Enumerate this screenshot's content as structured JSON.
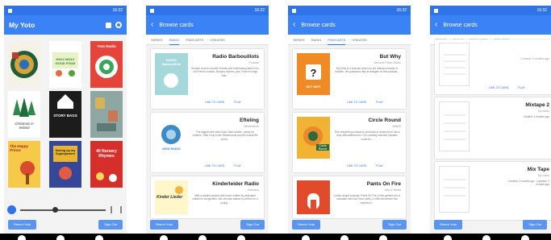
{
  "screens": [
    {
      "status_time": "16:32",
      "title": "My Yoto",
      "tile_texts": {
        "t2": "HOLY MOLY GOOD FOOD",
        "t3": "Yoto Radio",
        "t4": "Christmas in Ireland",
        "t5": "STORY BAGS",
        "t7": "The Happy Prince",
        "t8": "Saving up my Superpowers",
        "t9": "40 Nursery Rhymes"
      },
      "buttons": {
        "left": "Return Yoto",
        "right": "Sign Out"
      }
    },
    {
      "status_time": "16:32",
      "title": "Browse cards",
      "tabs": [
        "SERIES",
        "RADIO",
        "PODCASTS",
        "CREATED"
      ],
      "active_tab": 1,
      "cards": [
        {
          "title": "Radio Barbouillots",
          "subtitle": "Podcast",
          "desc": "Bonjour bout le monde! Enfants and entertaining tales from our French cousins. Nursery rhymes, jazz, French songs and...",
          "art": "RADIO Barbouillots"
        },
        {
          "title": "Efteling",
          "subtitle": "Netherlands",
          "desc": "The biggest and best Dutch radio station, purely for children. Take a trip to the Netherlands and the wonderful world...",
          "art": "KIDS RADIO"
        },
        {
          "title": "Kinderleider Radio",
          "subtitle": "Germany",
          "desc": "With a playlist packed with music written by dedicated children's songwriters, this German station is perfect for a young...",
          "art": "Kinder Lieder"
        }
      ],
      "card_btn_primary": "LINK TO CARD",
      "card_btn_secondary": "PLAY",
      "buttons": {
        "left": "Return Yoto",
        "right": "Sign Out"
      }
    },
    {
      "status_time": "16:32",
      "title": "Browse cards",
      "tabs": [
        "SERIES",
        "RADIO",
        "PODCASTS",
        "CREATED"
      ],
      "active_tab": 2,
      "cards": [
        {
          "title": "But Why",
          "subtitle": "Vermont Public Radio",
          "desc": "But Why is a podcast driven by the natural curiosity of children: the questions they investigate on this podcast...",
          "art": "BUT WHY"
        },
        {
          "title": "Circle Round",
          "subtitle": "WBUR",
          "desc": "This storytelling podcast is produced in America but has a truly international feel. Our carefully selected folktales come fro...",
          "art": "Circle Round"
        },
        {
          "title": "Pants On Fire",
          "subtitle": "Gen-Z Media",
          "desc": "A truly unique podcast, Pants On Fire, is the perfect mix of education and fun! Each week, a child interviewer two experts hi...",
          "art": ""
        }
      ],
      "card_btn_primary": "LINK TO CARD",
      "card_btn_secondary": "PLAY",
      "buttons": {
        "left": "Return Yoto",
        "right": "Sign Out"
      }
    },
    {
      "status_time": "16:32",
      "title": "Browse cards",
      "tabs": [
        "SERIES",
        "RADIO",
        "PODCASTS",
        "CREATED"
      ],
      "active_tab": 3,
      "cards": [
        {
          "title": "",
          "subtitle": "Created: 3 months ago",
          "desc": ""
        },
        {
          "title": "Mixtape 2",
          "subtitle": "My cards",
          "desc": "Created: 3 months ago"
        },
        {
          "title": "Mix Tape",
          "subtitle": "My cards",
          "desc": "Created: 3 months ago · Updated: 3 months ago"
        }
      ],
      "card_btn_primary": "LINK TO CARD",
      "card_btn_secondary": "PLAY",
      "buttons": {
        "left": "Return Yoto",
        "right": "Sign Out"
      }
    }
  ],
  "colors": {
    "primary": "#2f73e8",
    "appbar": "#3b82f6",
    "button": "#5a95f0"
  }
}
